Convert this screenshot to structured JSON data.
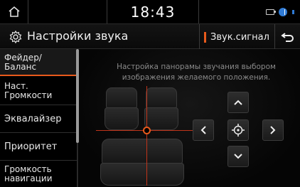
{
  "status": {
    "time": "18:43",
    "icons": [
      "home-icon",
      "sd-card-icon",
      "bluetooth-icon",
      "signal-icon"
    ]
  },
  "header": {
    "title": "Настройки звука",
    "beep_label": "Звук.сигнал",
    "icons": [
      "gear-icon",
      "back-icon"
    ]
  },
  "sidebar": {
    "items": [
      {
        "label": "Фейдер/\nБаланс",
        "active": true
      },
      {
        "label": "Наст.\nГромкости",
        "active": false
      },
      {
        "label": "Эквалайзер",
        "active": false
      },
      {
        "label": "Приоритет",
        "active": false
      },
      {
        "label": "Громкость\nнавигации",
        "active": false
      }
    ]
  },
  "main": {
    "description": "Настройка панорамы звучания выбором изображения желаемого положения.",
    "controls": [
      "up-arrow-icon",
      "left-arrow-icon",
      "center-target-icon",
      "right-arrow-icon",
      "down-arrow-icon"
    ]
  },
  "colors": {
    "accent": "#e85a1c",
    "background": "#000000",
    "text": "#e8e8e8",
    "muted_text": "#8a8a8a"
  }
}
